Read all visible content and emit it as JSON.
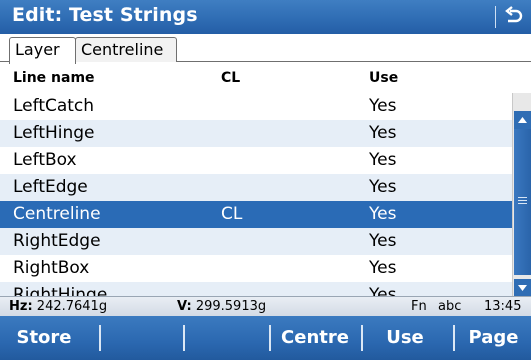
{
  "window": {
    "title": "Edit: Test Strings"
  },
  "tabs": [
    {
      "label": "Layer",
      "active": true
    },
    {
      "label": "Centreline",
      "active": false
    }
  ],
  "table": {
    "columns": [
      "Line name",
      "CL",
      "Use"
    ],
    "rows": [
      {
        "name": "LeftCatch",
        "cl": "",
        "use": "Yes"
      },
      {
        "name": "LeftHinge",
        "cl": "",
        "use": "Yes"
      },
      {
        "name": "LeftBox",
        "cl": "",
        "use": "Yes"
      },
      {
        "name": "LeftEdge",
        "cl": "",
        "use": "Yes"
      },
      {
        "name": "Centreline",
        "cl": "CL",
        "use": "Yes"
      },
      {
        "name": "RightEdge",
        "cl": "",
        "use": "Yes"
      },
      {
        "name": "RightBox",
        "cl": "",
        "use": "Yes"
      },
      {
        "name": "RightHinge",
        "cl": "",
        "use": "Yes"
      }
    ],
    "selected_row": 4
  },
  "status": {
    "hz_label": "Hz:",
    "hz_value": "242.7641g",
    "v_label": "V:",
    "v_value": "299.5913g",
    "mode_fn": "Fn",
    "mode_input": "abc",
    "time": "13:45"
  },
  "fkeys": {
    "f1": "Store",
    "f2": "",
    "f3": "",
    "f4": "Centre",
    "f5": "Use",
    "f6": "Page"
  },
  "colors": {
    "accent": "#2f6db4",
    "selected_row": "#2a6bb6",
    "alt_row": "#e6eef7"
  },
  "icons": {
    "back": "back-arrow-icon"
  }
}
